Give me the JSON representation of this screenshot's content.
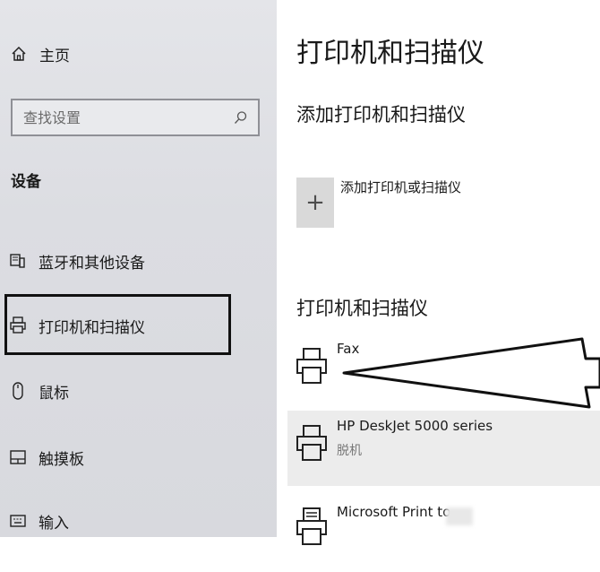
{
  "sidebar": {
    "home_label": "主页",
    "search_placeholder": "查找设置",
    "section_title": "设备",
    "items": [
      {
        "label": "蓝牙和其他设备",
        "icon": "bluetooth-devices-icon"
      },
      {
        "label": "打印机和扫描仪",
        "icon": "printer-icon",
        "selected": true
      },
      {
        "label": "鼠标",
        "icon": "mouse-icon"
      },
      {
        "label": "触摸板",
        "icon": "touchpad-icon"
      },
      {
        "label": "输入",
        "icon": "keyboard-icon"
      }
    ]
  },
  "main": {
    "page_title": "打印机和扫描仪",
    "add_section_title": "添加打印机和扫描仪",
    "add_button_symbol": "+",
    "add_button_label": "添加打印机或扫描仪",
    "list_title": "打印机和扫描仪",
    "printers": [
      {
        "name": "Fax",
        "status": ""
      },
      {
        "name": "HP DeskJet 5000 series",
        "status": "脱机",
        "selected": true
      },
      {
        "name": "Microsoft Print to ",
        "status": ""
      }
    ]
  },
  "colors": {
    "sidebar_bg": "#dcdde2",
    "selected_row_bg": "#ececec",
    "highlight_border": "#111111",
    "add_button_bg": "#d9d9d9"
  }
}
